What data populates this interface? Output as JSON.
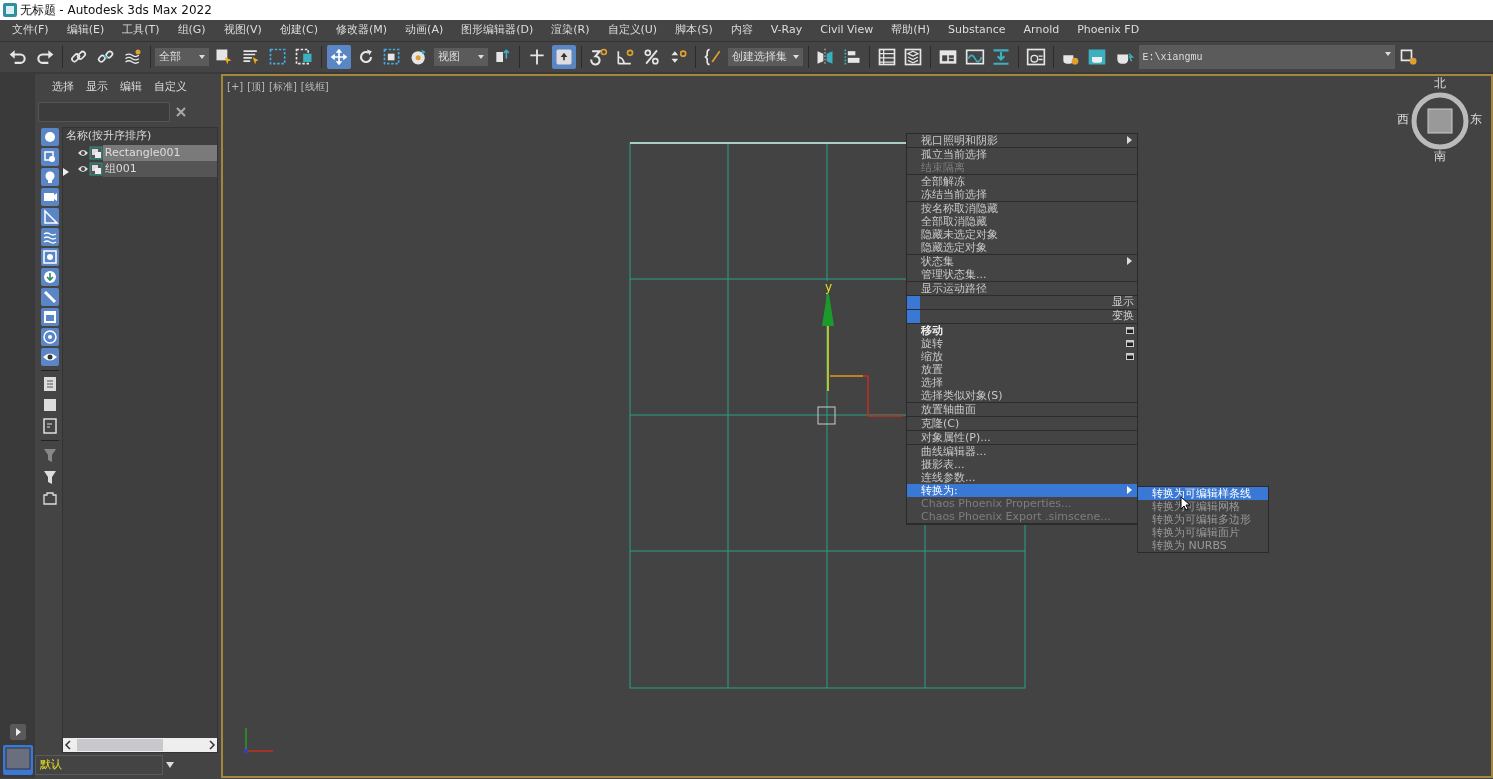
{
  "window": {
    "title": "无标题 - Autodesk 3ds Max 2022"
  },
  "menu_bar": [
    "文件(F)",
    "编辑(E)",
    "工具(T)",
    "组(G)",
    "视图(V)",
    "创建(C)",
    "修改器(M)",
    "动画(A)",
    "图形编辑器(D)",
    "渲染(R)",
    "自定义(U)",
    "脚本(S)",
    "内容",
    "V-Ray",
    "Civil View",
    "帮助(H)",
    "Substance",
    "Arnold",
    "Phoenix FD"
  ],
  "toolbar": [
    {
      "kind": "tool",
      "active": false
    },
    {
      "kind": "tool",
      "active": false
    },
    {
      "kind": "divider"
    },
    {
      "kind": "tool",
      "active": false
    },
    {
      "kind": "tool",
      "active": false
    },
    {
      "kind": "tool",
      "active": false
    },
    {
      "kind": "divider"
    },
    {
      "kind": "dropdown",
      "value": "全部"
    },
    {
      "kind": "tool",
      "active": false
    },
    {
      "kind": "tool",
      "active": false
    },
    {
      "kind": "tool",
      "active": false
    },
    {
      "kind": "tool",
      "active": false
    },
    {
      "kind": "divider"
    },
    {
      "kind": "tool",
      "active": true
    },
    {
      "kind": "tool",
      "active": false
    },
    {
      "kind": "tool",
      "active": false
    },
    {
      "kind": "tool",
      "active": false
    },
    {
      "kind": "dropdown",
      "value": "视图"
    },
    {
      "kind": "tool",
      "active": false
    },
    {
      "kind": "divider"
    },
    {
      "kind": "tool",
      "active": false
    },
    {
      "kind": "tool",
      "active": true
    },
    {
      "kind": "divider"
    },
    {
      "kind": "tool",
      "active": false
    },
    {
      "kind": "tool",
      "active": false
    },
    {
      "kind": "tool",
      "active": false
    },
    {
      "kind": "tool",
      "active": false
    },
    {
      "kind": "divider"
    },
    {
      "kind": "tool",
      "active": false
    },
    {
      "kind": "dropdown",
      "value": "创建选择集"
    },
    {
      "kind": "divider"
    },
    {
      "kind": "tool",
      "active": false
    },
    {
      "kind": "tool",
      "active": false
    },
    {
      "kind": "divider"
    },
    {
      "kind": "tool",
      "active": false
    },
    {
      "kind": "tool",
      "active": false
    },
    {
      "kind": "divider"
    },
    {
      "kind": "tool",
      "active": false
    },
    {
      "kind": "tool",
      "active": false
    },
    {
      "kind": "tool",
      "active": false
    },
    {
      "kind": "divider"
    },
    {
      "kind": "tool",
      "active": false
    },
    {
      "kind": "divider"
    },
    {
      "kind": "tool",
      "active": false
    },
    {
      "kind": "tool",
      "active": false
    },
    {
      "kind": "tool",
      "active": false
    },
    {
      "kind": "path",
      "value": "E:\\xiangmu"
    },
    {
      "kind": "tool",
      "active": false
    }
  ],
  "scene_explorer": {
    "tabs": [
      "选择",
      "显示",
      "编辑",
      "自定义"
    ],
    "filters": [
      {
        "on": true
      },
      {
        "on": true
      },
      {
        "on": true
      },
      {
        "on": true
      },
      {
        "on": true
      },
      {
        "on": true
      },
      {
        "on": true
      },
      {
        "on": true
      },
      {
        "on": true
      },
      {
        "on": true
      },
      {
        "on": true
      },
      {
        "on": true
      }
    ],
    "column_header": "名称(按升序排序)",
    "rows": [
      {
        "name": "Rectangle001",
        "selected": true,
        "expandable": false
      },
      {
        "name": "组001",
        "selected": false,
        "expandable": true
      }
    ],
    "layer": "默认"
  },
  "viewport": {
    "labels": [
      "[+]",
      "[顶]",
      "[标准]",
      "[线框]"
    ],
    "gizmo_label": "y",
    "compass": [
      "北",
      "西",
      "东",
      "南"
    ]
  },
  "context_menu": {
    "groups": [
      {
        "items": [
          {
            "label": "视口照明和阴影",
            "kind": "submenu",
            "disabled": false,
            "selected": false
          }
        ]
      },
      {
        "items": [
          {
            "label": "孤立当前选择",
            "kind": "item",
            "disabled": false,
            "selected": false
          },
          {
            "label": "结束隔离",
            "kind": "item",
            "disabled": true,
            "selected": false
          }
        ]
      },
      {
        "items": [
          {
            "label": "全部解冻",
            "kind": "item",
            "disabled": false,
            "selected": false
          },
          {
            "label": "冻结当前选择",
            "kind": "item",
            "disabled": false,
            "selected": false
          }
        ]
      },
      {
        "items": [
          {
            "label": "按名称取消隐藏",
            "kind": "item",
            "disabled": false,
            "selected": false
          },
          {
            "label": "全部取消隐藏",
            "kind": "item",
            "disabled": false,
            "selected": false
          },
          {
            "label": "隐藏未选定对象",
            "kind": "item",
            "disabled": false,
            "selected": false
          },
          {
            "label": "隐藏选定对象",
            "kind": "item",
            "disabled": false,
            "selected": false
          }
        ]
      },
      {
        "items": [
          {
            "label": "状态集",
            "kind": "submenu",
            "disabled": false,
            "selected": false
          },
          {
            "label": "管理状态集...",
            "kind": "item",
            "disabled": false,
            "selected": false
          }
        ]
      },
      {
        "items": [
          {
            "label": "显示运动路径",
            "kind": "item",
            "disabled": false,
            "selected": false
          }
        ]
      },
      {
        "items": [
          {
            "label": "显示",
            "kind": "header"
          }
        ]
      },
      {
        "items": [
          {
            "label": "变换",
            "kind": "header"
          }
        ]
      },
      {
        "items": [
          {
            "label": "移动",
            "kind": "default-option",
            "disabled": false,
            "selected": false
          },
          {
            "label": "旋转",
            "kind": "option",
            "disabled": false,
            "selected": false
          },
          {
            "label": "缩放",
            "kind": "option",
            "disabled": false,
            "selected": false
          },
          {
            "label": "放置",
            "kind": "item",
            "disabled": false,
            "selected": false
          },
          {
            "label": "选择",
            "kind": "item",
            "disabled": false,
            "selected": false
          },
          {
            "label": "选择类似对象(S)",
            "kind": "item",
            "disabled": false,
            "selected": false
          }
        ]
      },
      {
        "items": [
          {
            "label": "放置轴曲面",
            "kind": "item",
            "disabled": false,
            "selected": false
          }
        ]
      },
      {
        "items": [
          {
            "label": "克隆(C)",
            "kind": "item",
            "disabled": false,
            "selected": false
          }
        ]
      },
      {
        "items": [
          {
            "label": "对象属性(P)...",
            "kind": "item",
            "disabled": false,
            "selected": false
          }
        ]
      },
      {
        "items": [
          {
            "label": "曲线编辑器...",
            "kind": "item",
            "disabled": false,
            "selected": false
          },
          {
            "label": "摄影表...",
            "kind": "item",
            "disabled": false,
            "selected": false
          },
          {
            "label": "连线参数...",
            "kind": "item",
            "disabled": false,
            "selected": false
          },
          {
            "label": "转换为:",
            "kind": "submenu",
            "disabled": false,
            "selected": true
          },
          {
            "label": "Chaos Phoenix Properties...",
            "kind": "item",
            "disabled": true,
            "selected": false
          },
          {
            "label": "Chaos Phoenix Export .simscene...",
            "kind": "item",
            "disabled": true,
            "selected": false
          }
        ]
      }
    ]
  },
  "submenu": [
    {
      "label": "转换为可编辑样条线",
      "selected": true
    },
    {
      "label": "转换为可编辑网格",
      "selected": false
    },
    {
      "label": "转换为可编辑多边形",
      "selected": false
    },
    {
      "label": "转换为可编辑面片",
      "selected": false
    },
    {
      "label": "转换为 NURBS",
      "selected": false
    }
  ]
}
